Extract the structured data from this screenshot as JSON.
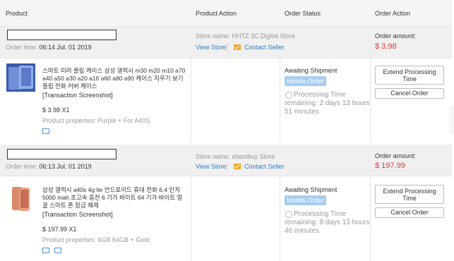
{
  "columns": {
    "product": "Product",
    "product_action": "Product Action",
    "order_status": "Order Status",
    "order_action": "Order Action"
  },
  "orders": [
    {
      "order_time_label": "Order time:",
      "order_time": "06:14 Jul. 01 2019",
      "store_label": "Store name:",
      "store_name": "HHTZ 3C Digital Store",
      "view_store": "View Store",
      "contact_seller": "Contact Seller",
      "amount_label": "Order amount:",
      "amount": "$ 3.98",
      "product_name": "스마트 미러 플립 케이스 삼성 갤럭시 m30 m20 m10 a70 a40 a50 a30 a20 a10 a60 a80 a90 케이스 지우기 보기 플립 전화 커버 케이스",
      "transaction_screenshot": "[Transaction Screenshot]",
      "price_qty": "$ 3.98 X1",
      "product_properties": "Product properties: Purple + For A40S",
      "status": "Awaiting Shipment",
      "mobile_badge": "Mobile Order",
      "processing_time": "Processing Time remaining: 2 days 13 hours 51 minutes",
      "extend_button": "Extend Processing Time",
      "cancel_button": "Cancel Order"
    },
    {
      "order_time_label": "Order time:",
      "order_time": "06:13 Jul. 01 2019",
      "store_label": "Store name:",
      "store_name": "ebestbuy Store",
      "view_store": "View Store",
      "contact_seller": "Contact Seller",
      "amount_label": "Order amount:",
      "amount": "$ 197.99",
      "product_name": "삼성 갤럭시 a40s 4g lte 안드로이드 휴대 전화 6.4 인치 5000 mah 초고속 충전 6 기가 바이트 64 기가 바이트 얼굴 스마트 폰 잠금 해제",
      "transaction_screenshot": "[Transaction Screenshot]",
      "price_qty": "$ 197.99 X1",
      "product_properties": "Product properties: 6GB 64GB + Gold",
      "status": "Awaiting Shipment",
      "mobile_badge": "Mobile Order",
      "processing_time": "Processing Time remaining: 8 days 13 hours 46 minutes",
      "extend_button": "Extend Processing Time",
      "cancel_button": "Cancel Order"
    }
  ],
  "colors": {
    "price_red": "#e4393c",
    "link_blue": "#2a7ec4",
    "badge_blue": "#a6cdf0",
    "mail_orange": "#f6a623"
  },
  "icons": [
    "mail-icon",
    "clock-icon",
    "truck-icon",
    "invoice-icon"
  ]
}
